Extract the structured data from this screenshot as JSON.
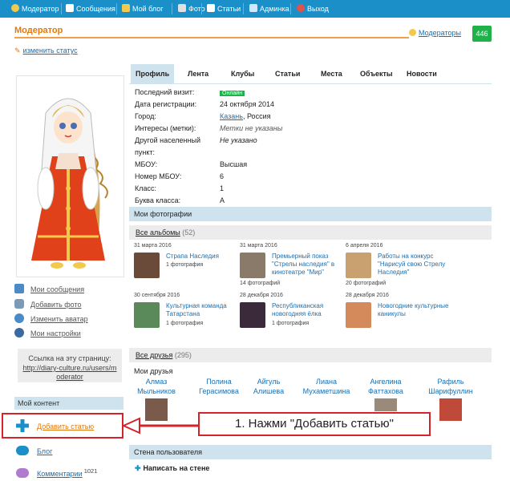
{
  "nav": {
    "items": [
      {
        "label": "Модератор",
        "icon": "user-icon",
        "color": "#f2c94c"
      },
      {
        "label": "Сообщения",
        "icon": "envelope-icon",
        "color": "#ffffff"
      },
      {
        "label": "Мой блог",
        "icon": "book-icon",
        "color": "#f2c94c"
      },
      {
        "label": "Фото",
        "icon": "camera-icon",
        "color": "#e0e0e0"
      },
      {
        "label": "Статьи",
        "icon": "document-icon",
        "color": "#ffffff"
      },
      {
        "label": "Админка",
        "icon": "database-icon",
        "color": "#d0e7ff"
      },
      {
        "label": "Выход",
        "icon": "close-circle-icon",
        "color": "#e0524a"
      }
    ]
  },
  "header": {
    "title": "Модератор",
    "moderators_link": "Модераторы",
    "counter": "446",
    "change_status": "изменить статус"
  },
  "tabs": [
    "Профиль",
    "Лента",
    "Клубы",
    "Статьи",
    "Места",
    "Объекты",
    "Новости"
  ],
  "profile": [
    {
      "label": "Последний визит:",
      "value": "Онлайн",
      "type": "badge"
    },
    {
      "label": "Дата регистрации:",
      "value": "24 октября 2014",
      "type": "text"
    },
    {
      "label": "Город:",
      "value": "Казань",
      "value2": ", Россия",
      "type": "link"
    },
    {
      "label": "Интересы (метки):",
      "value": "Метки не указаны",
      "type": "italic"
    },
    {
      "label": "Другой населенный",
      "label2": "пункт:",
      "value": "Не указано",
      "type": "italic"
    },
    {
      "label": "МБОУ:",
      "value": "Высшая",
      "type": "text"
    },
    {
      "label": "Номер МБОУ:",
      "value": "6",
      "type": "text"
    },
    {
      "label": "Класс:",
      "value": "1",
      "type": "text"
    },
    {
      "label": "Буква класса:",
      "value": "А",
      "type": "text"
    }
  ],
  "photos": {
    "section_title": "Мои фотографии",
    "all_albums": "Все альбомы",
    "albums_count": "(52)",
    "albums": [
      {
        "date": "31 марта 2016",
        "title": "Страпа Наследия",
        "count": "1 фотография",
        "color": "#6a4b3a"
      },
      {
        "date": "31 марта 2016",
        "title": "Премьерный показ \"Стрелы наследия\" в кинотеатре \"Мир\"",
        "count": "14 фотографий",
        "color": "#8a7a6a"
      },
      {
        "date": "6 апреля 2016",
        "title": "Работы на конкурс \"Нарисуй свою Стрелу Наследия\"",
        "count": "20 фотографий",
        "color": "#c9a070"
      },
      {
        "date": "30 сентября 2016",
        "title": "Культурная команда Татарстана",
        "count": "1 фотография",
        "color": "#5a8a5a"
      },
      {
        "date": "28 декабря 2016",
        "title": "Республиканская новогодняя ёлка",
        "count": "1 фотография",
        "color": "#3a2a3a"
      },
      {
        "date": "28 декабря 2016",
        "title": "Новогодние культурные каникулы",
        "count": "1 фотография",
        "color": "#d48a5a"
      }
    ]
  },
  "friends": {
    "all_friends": "Все друзья",
    "count": "(295)",
    "title": "Мои друзья",
    "list": [
      {
        "first": "Алмаз",
        "last": "Мыльников"
      },
      {
        "first": "Полина",
        "last": "Герасимова"
      },
      {
        "first": "Айгуль",
        "last": "Алишева"
      },
      {
        "first": "Лиана",
        "last": "Мухаметшина"
      },
      {
        "first": "Ангелина",
        "last": "Фаттахова"
      },
      {
        "first": "Рафиль",
        "last": "Шарифуллин"
      }
    ]
  },
  "sidebar": {
    "links": [
      {
        "label": "Мои сообщения",
        "icon": "envelope-icon"
      },
      {
        "label": "Добавить фото",
        "icon": "camera-icon"
      },
      {
        "label": "Изменить аватар",
        "icon": "person-icon"
      },
      {
        "label": "Мои настройки",
        "icon": "gear-icon"
      }
    ],
    "link_box_text": "Ссылка на эту страницу:",
    "link_box_url": "http://diary-culture.ru/users/moderator",
    "my_content": "Мой контент",
    "add_article": "Добавить статью",
    "blog": "Блог",
    "comments": "Комментарии",
    "comments_count": "1021"
  },
  "callout": "1. Нажми \"Добавить статью\"",
  "wall": {
    "title": "Стена пользователя",
    "write": "Написать на стене"
  }
}
